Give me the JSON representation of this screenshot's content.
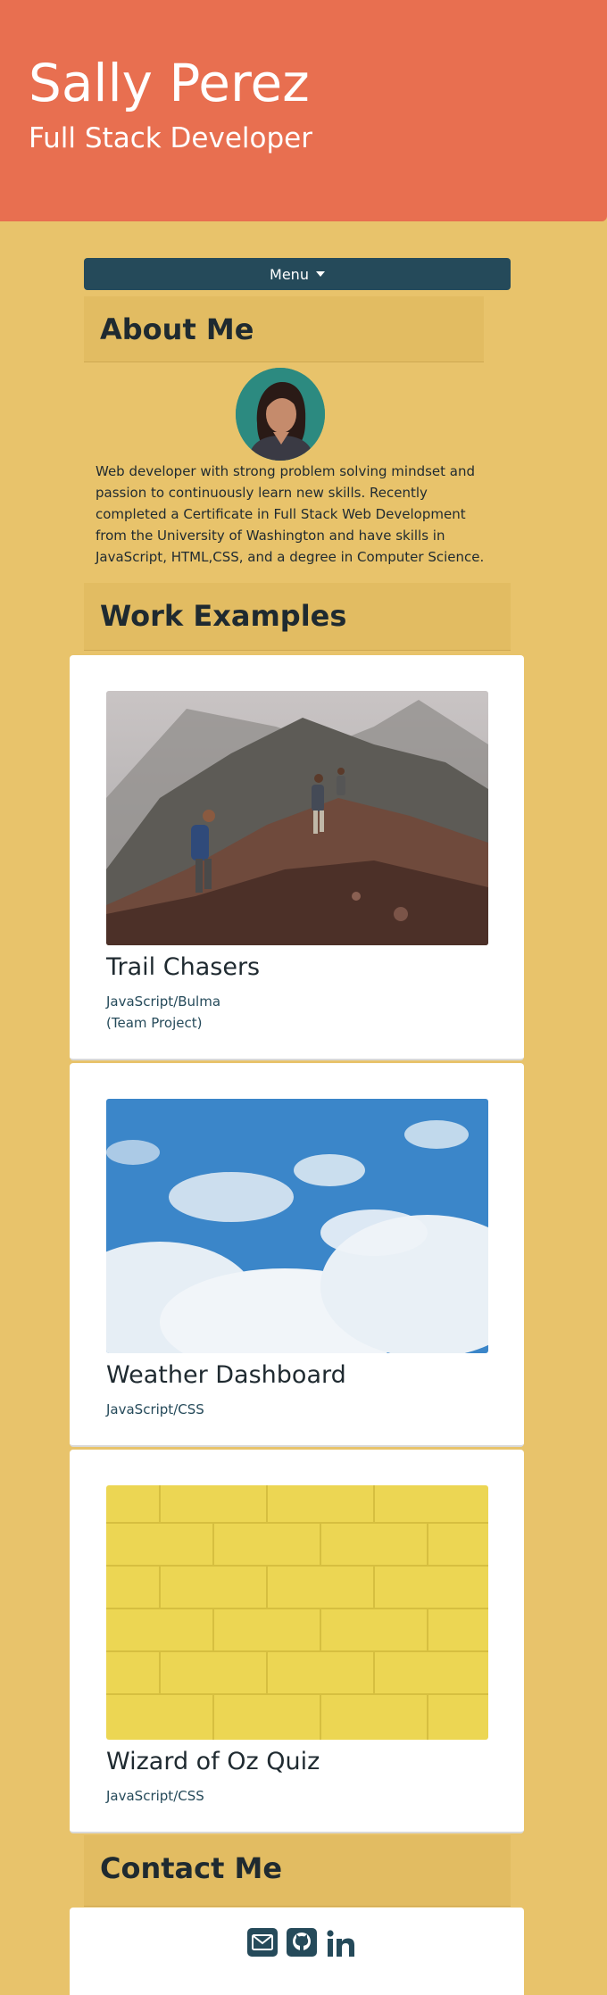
{
  "header": {
    "name": "Sally Perez",
    "role": "Full Stack Developer"
  },
  "nav": {
    "menu_label": "Menu"
  },
  "about": {
    "heading": "About Me",
    "bio": "Web developer with strong problem solving mindset and passion to continuously learn new skills. Recently completed a Certificate in Full Stack Web Development from the University of Washington and have skills in JavaScript, HTML,CSS, and a degree in Computer Science."
  },
  "work": {
    "heading": "Work Examples",
    "projects": [
      {
        "title": "Trail Chasers",
        "tech": "JavaScript/Bulma",
        "note": "(Team Project)"
      },
      {
        "title": "Weather Dashboard",
        "tech": "JavaScript/CSS"
      },
      {
        "title": "Wizard of Oz Quiz",
        "tech": "JavaScript/CSS"
      }
    ]
  },
  "contact": {
    "heading": "Contact Me",
    "icons": [
      "envelope-icon",
      "github-icon",
      "linkedin-icon"
    ]
  },
  "colors": {
    "header_bg": "#e86f50",
    "page_bg": "#e8c36b",
    "heading_bg": "#e2bc62",
    "menu_bg": "#254a5a",
    "card_bg": "#ffffff",
    "icon_color": "#254a5a"
  }
}
